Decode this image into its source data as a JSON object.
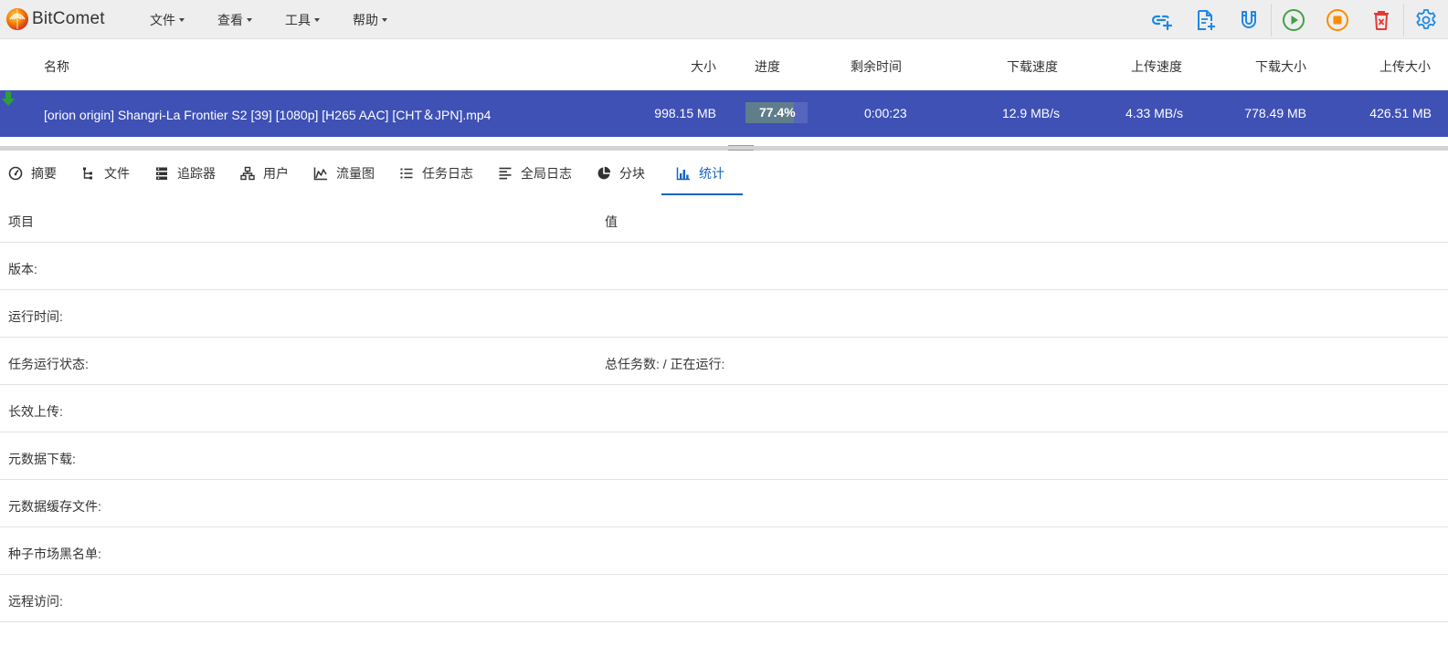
{
  "app": {
    "title": "BitComet"
  },
  "menu": [
    {
      "label": "文件"
    },
    {
      "label": "查看"
    },
    {
      "label": "工具"
    },
    {
      "label": "帮助"
    }
  ],
  "toolbar_icons": [
    "add-link-icon",
    "add-torrent-file-icon",
    "magnet-icon",
    "start-icon",
    "stop-icon",
    "delete-icon",
    "settings-icon"
  ],
  "task_list": {
    "columns": {
      "name": "名称",
      "size": "大小",
      "progress": "进度",
      "remaining": "剩余时间",
      "download_speed": "下载速度",
      "upload_speed": "上传速度",
      "downloaded": "下载大小",
      "uploaded": "上传大小"
    },
    "tasks": [
      {
        "name": "[orion origin] Shangri-La Frontier S2 [39] [1080p] [H265 AAC] [CHT＆JPN].mp4",
        "size": "998.15 MB",
        "progress": "77.4%",
        "progress_fraction": 0.774,
        "remaining": "0:00:23",
        "download_speed": "12.9 MB/s",
        "upload_speed": "4.33 MB/s",
        "downloaded": "778.49 MB",
        "uploaded": "426.51 MB"
      }
    ]
  },
  "tabs": [
    {
      "label": "摘要"
    },
    {
      "label": "文件"
    },
    {
      "label": "追踪器"
    },
    {
      "label": "用户"
    },
    {
      "label": "流量图"
    },
    {
      "label": "任务日志"
    },
    {
      "label": "全局日志"
    },
    {
      "label": "分块"
    },
    {
      "label": "统计",
      "active": true
    }
  ],
  "stats": {
    "header": {
      "item": "项目",
      "value": "值"
    },
    "rows": [
      {
        "item": "版本:",
        "value": ""
      },
      {
        "item": "运行时间:",
        "value": ""
      },
      {
        "item": "任务运行状态:",
        "value": "总任务数: / 正在运行:"
      },
      {
        "item": "长效上传:",
        "value": ""
      },
      {
        "item": "元数据下载:",
        "value": ""
      },
      {
        "item": "元数据缓存文件:",
        "value": ""
      },
      {
        "item": "种子市场黑名单:",
        "value": ""
      },
      {
        "item": "远程访问:",
        "value": ""
      }
    ]
  },
  "colors": {
    "selected_row": "#3f51b5",
    "progress_fill": "#607d8b",
    "active_tab": "#1565c0",
    "download_arrow": "#2e9e3a"
  }
}
